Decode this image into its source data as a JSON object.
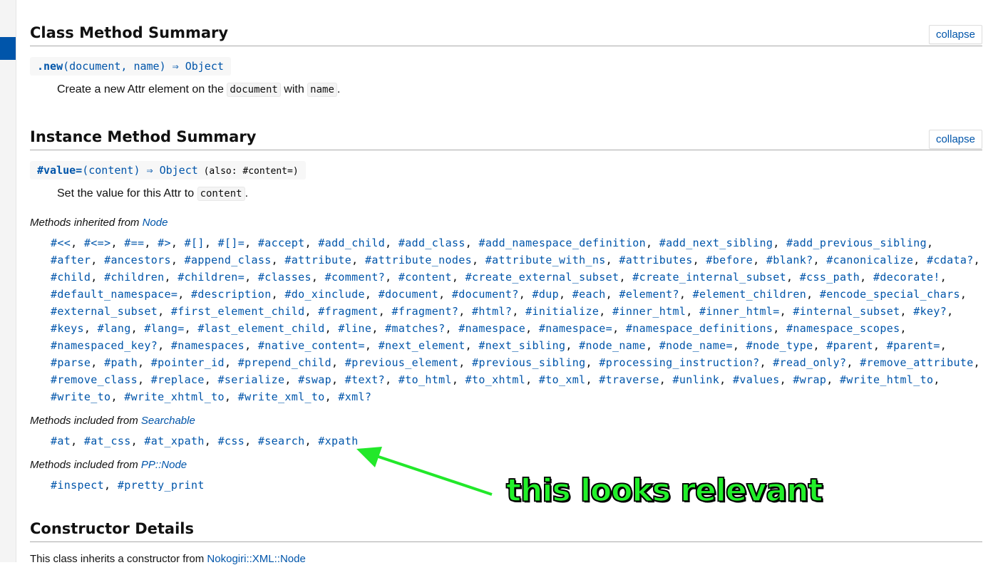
{
  "class_method_summary": {
    "title": "Class Method Summary",
    "collapse_label": "collapse",
    "method": {
      "name": ".new",
      "params": "(document, name)",
      "returns": " ⇒ Object"
    },
    "doc_prefix": "Create a new Attr element on the",
    "doc_code1": "document",
    "doc_mid": "with",
    "doc_code2": "name",
    "doc_suffix": "."
  },
  "instance_method_summary": {
    "title": "Instance Method Summary",
    "collapse_label": "collapse",
    "method": {
      "name": "#value=",
      "params": "(content)",
      "returns": " ⇒ Object",
      "also": " (also: #content=)"
    },
    "doc_prefix": "Set the value for this Attr to",
    "doc_code": "content",
    "doc_suffix": "."
  },
  "inherited": [
    {
      "heading": "Methods inherited from",
      "source": "Node",
      "methods": [
        "#<<",
        "#<=>",
        "#==",
        "#>",
        "#[]",
        "#[]=",
        "#accept",
        "#add_child",
        "#add_class",
        "#add_namespace_definition",
        "#add_next_sibling",
        "#add_previous_sibling",
        "#after",
        "#ancestors",
        "#append_class",
        "#attribute",
        "#attribute_nodes",
        "#attribute_with_ns",
        "#attributes",
        "#before",
        "#blank?",
        "#canonicalize",
        "#cdata?",
        "#child",
        "#children",
        "#children=",
        "#classes",
        "#comment?",
        "#content",
        "#create_external_subset",
        "#create_internal_subset",
        "#css_path",
        "#decorate!",
        "#default_namespace=",
        "#description",
        "#do_xinclude",
        "#document",
        "#document?",
        "#dup",
        "#each",
        "#element?",
        "#element_children",
        "#encode_special_chars",
        "#external_subset",
        "#first_element_child",
        "#fragment",
        "#fragment?",
        "#html?",
        "#initialize",
        "#inner_html",
        "#inner_html=",
        "#internal_subset",
        "#key?",
        "#keys",
        "#lang",
        "#lang=",
        "#last_element_child",
        "#line",
        "#matches?",
        "#namespace",
        "#namespace=",
        "#namespace_definitions",
        "#namespace_scopes",
        "#namespaced_key?",
        "#namespaces",
        "#native_content=",
        "#next_element",
        "#next_sibling",
        "#node_name",
        "#node_name=",
        "#node_type",
        "#parent",
        "#parent=",
        "#parse",
        "#path",
        "#pointer_id",
        "#prepend_child",
        "#previous_element",
        "#previous_sibling",
        "#processing_instruction?",
        "#read_only?",
        "#remove_attribute",
        "#remove_class",
        "#replace",
        "#serialize",
        "#swap",
        "#text?",
        "#to_html",
        "#to_xhtml",
        "#to_xml",
        "#traverse",
        "#unlink",
        "#values",
        "#wrap",
        "#write_html_to",
        "#write_to",
        "#write_xhtml_to",
        "#write_xml_to",
        "#xml?"
      ]
    },
    {
      "heading": "Methods included from",
      "source": "Searchable",
      "methods": [
        "#at",
        "#at_css",
        "#at_xpath",
        "#css",
        "#search",
        "#xpath"
      ]
    },
    {
      "heading": "Methods included from",
      "source": "PP::Node",
      "methods": [
        "#inspect",
        "#pretty_print"
      ]
    }
  ],
  "annotation": {
    "text": "this looks relevant",
    "color": "#22f02a"
  },
  "constructor_details": {
    "title": "Constructor Details",
    "text": "This class inherits a constructor from",
    "link": "Nokogiri::XML::Node"
  },
  "colors": {
    "link": "#05a",
    "sidebar_active": "#05a"
  }
}
